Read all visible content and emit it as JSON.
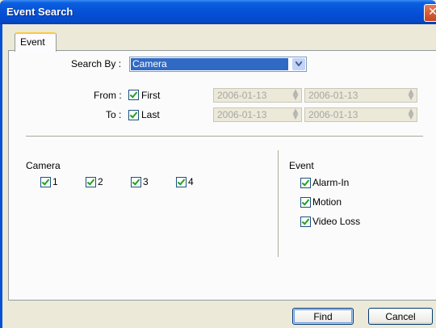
{
  "window": {
    "title": "Event Search",
    "close_glyph": "✕"
  },
  "tabs": [
    {
      "label": "Event"
    }
  ],
  "search_by": {
    "label": "Search By :",
    "value": "Camera"
  },
  "from": {
    "label": "From :",
    "checkbox_label": "First",
    "checked": true,
    "date1": "2006-01-13",
    "date2": "2006-01-13"
  },
  "to": {
    "label": "To :",
    "checkbox_label": "Last",
    "checked": true,
    "date1": "2006-01-13",
    "date2": "2006-01-13"
  },
  "camera": {
    "title": "Camera",
    "items": [
      {
        "label": "1",
        "checked": true
      },
      {
        "label": "2",
        "checked": true
      },
      {
        "label": "3",
        "checked": true
      },
      {
        "label": "4",
        "checked": true
      }
    ]
  },
  "event": {
    "title": "Event",
    "items": [
      {
        "label": "Alarm-In",
        "checked": true
      },
      {
        "label": "Motion",
        "checked": true
      },
      {
        "label": "Video Loss",
        "checked": true
      }
    ]
  },
  "buttons": {
    "find": "Find",
    "cancel": "Cancel"
  },
  "icons": {
    "close": "close-icon",
    "dropdown": "chevron-down-icon",
    "spinner": "spinner-icon"
  },
  "colors": {
    "titlebar": "#0551d6",
    "selection": "#316ac5",
    "check": "#21a121",
    "window_bg": "#ece9d8"
  }
}
